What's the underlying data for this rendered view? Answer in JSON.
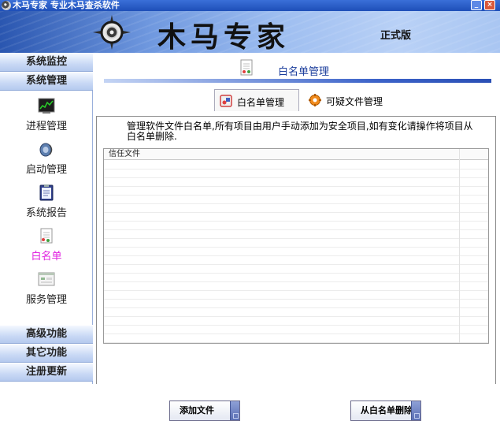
{
  "window": {
    "title": "木马专家  专业木马查杀软件",
    "minimize_glyph": "_",
    "close_glyph": "×"
  },
  "banner": {
    "title": "木马专家",
    "edition": "正式版"
  },
  "sidebar": {
    "sections_top": [
      {
        "label": "系统监控"
      },
      {
        "label": "系统管理"
      }
    ],
    "items": [
      {
        "label": "进程管理",
        "icon": "process-monitor-icon"
      },
      {
        "label": "启动管理",
        "icon": "startup-speaker-icon"
      },
      {
        "label": "系统报告",
        "icon": "clipboard-report-icon"
      },
      {
        "label": "白名单",
        "icon": "whitelist-document-icon",
        "active": true
      },
      {
        "label": "服务管理",
        "icon": "service-window-icon"
      }
    ],
    "sections_bottom": [
      {
        "label": "高级功能"
      },
      {
        "label": "其它功能"
      },
      {
        "label": "注册更新"
      }
    ]
  },
  "main": {
    "page_title": "白名单管理",
    "tabs": [
      {
        "label": "白名单管理",
        "icon": "whitelist-tab-icon",
        "selected": true
      },
      {
        "label": "可疑文件管理",
        "icon": "gear-icon",
        "selected": false
      }
    ],
    "description": "管理软件文件白名单,所有项目由用户手动添加为安全项目,如有变化请操作将项目从白名单删除.",
    "list": {
      "columns": [
        "信任文件"
      ]
    },
    "buttons": {
      "add": "添加文件",
      "remove": "从白名单删除"
    }
  },
  "colors": {
    "accent": "#3c63c9",
    "active_item": "#e020e0",
    "title_text": "#1c3e9c"
  }
}
